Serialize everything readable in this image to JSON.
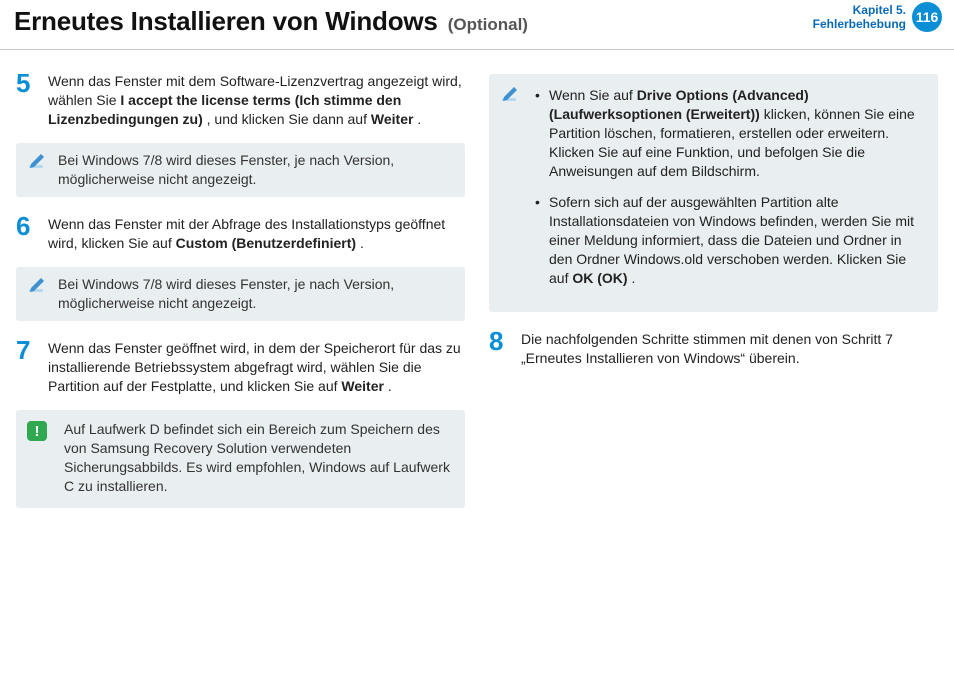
{
  "header": {
    "title": "Erneutes Installieren von Windows",
    "subtitle": "(Optional)",
    "chapter_line1": "Kapitel 5.",
    "chapter_line2": "Fehlerbehebung",
    "page_number": "116"
  },
  "left": {
    "step5": {
      "num": "5",
      "t1": "Wenn das Fenster mit dem Software-Lizenzvertrag angezeigt wird, wählen Sie ",
      "b1": "I accept the license terms (Ich stimme den Lizenzbedingungen zu)",
      "t2": ", und klicken Sie dann auf ",
      "b2": "Weiter",
      "t3": "."
    },
    "note5": "Bei Windows 7/8 wird dieses Fenster, je nach Version, möglicherweise nicht angezeigt.",
    "step6": {
      "num": "6",
      "t1": "Wenn das Fenster mit der Abfrage des Installationstyps geöffnet wird, klicken Sie auf ",
      "b1": "Custom (Benutzerdefiniert)",
      "t2": "."
    },
    "note6": "Bei Windows 7/8 wird dieses Fenster, je nach Version, möglicherweise nicht angezeigt.",
    "step7": {
      "num": "7",
      "t1": "Wenn das Fenster geöffnet wird, in dem der Speicherort für das zu installierende Betriebssystem abgefragt wird, wählen Sie die Partition auf der Festplatte, und klicken Sie auf ",
      "b1": "Weiter",
      "t2": "."
    },
    "warn7": "Auf Laufwerk D befindet sich ein Bereich zum Speichern des von Samsung Recovery Solution verwendeten Sicherungsabbilds. Es wird empfohlen, Windows auf Laufwerk C zu installieren."
  },
  "right": {
    "bullet1": {
      "t1": "Wenn Sie auf ",
      "b1": "Drive Options (Advanced) (Laufwerksoptionen (Erweitert))",
      "t2": " klicken, können Sie eine Partition löschen, formatieren, erstellen oder erweitern. Klicken Sie auf eine Funktion, und befolgen Sie die Anweisungen auf dem Bildschirm."
    },
    "bullet2": {
      "t1": "Sofern sich auf der ausgewählten Partition alte Installationsdateien von Windows befinden, werden Sie mit einer Meldung informiert, dass die Dateien und Ordner in den Ordner Windows.old verschoben werden. Klicken Sie auf ",
      "b1": "OK (OK)",
      "t2": "."
    },
    "step8": {
      "num": "8",
      "t1": "Die nachfolgenden Schritte stimmen mit denen von Schritt 7 „Erneutes Installieren von Windows“ überein."
    }
  }
}
